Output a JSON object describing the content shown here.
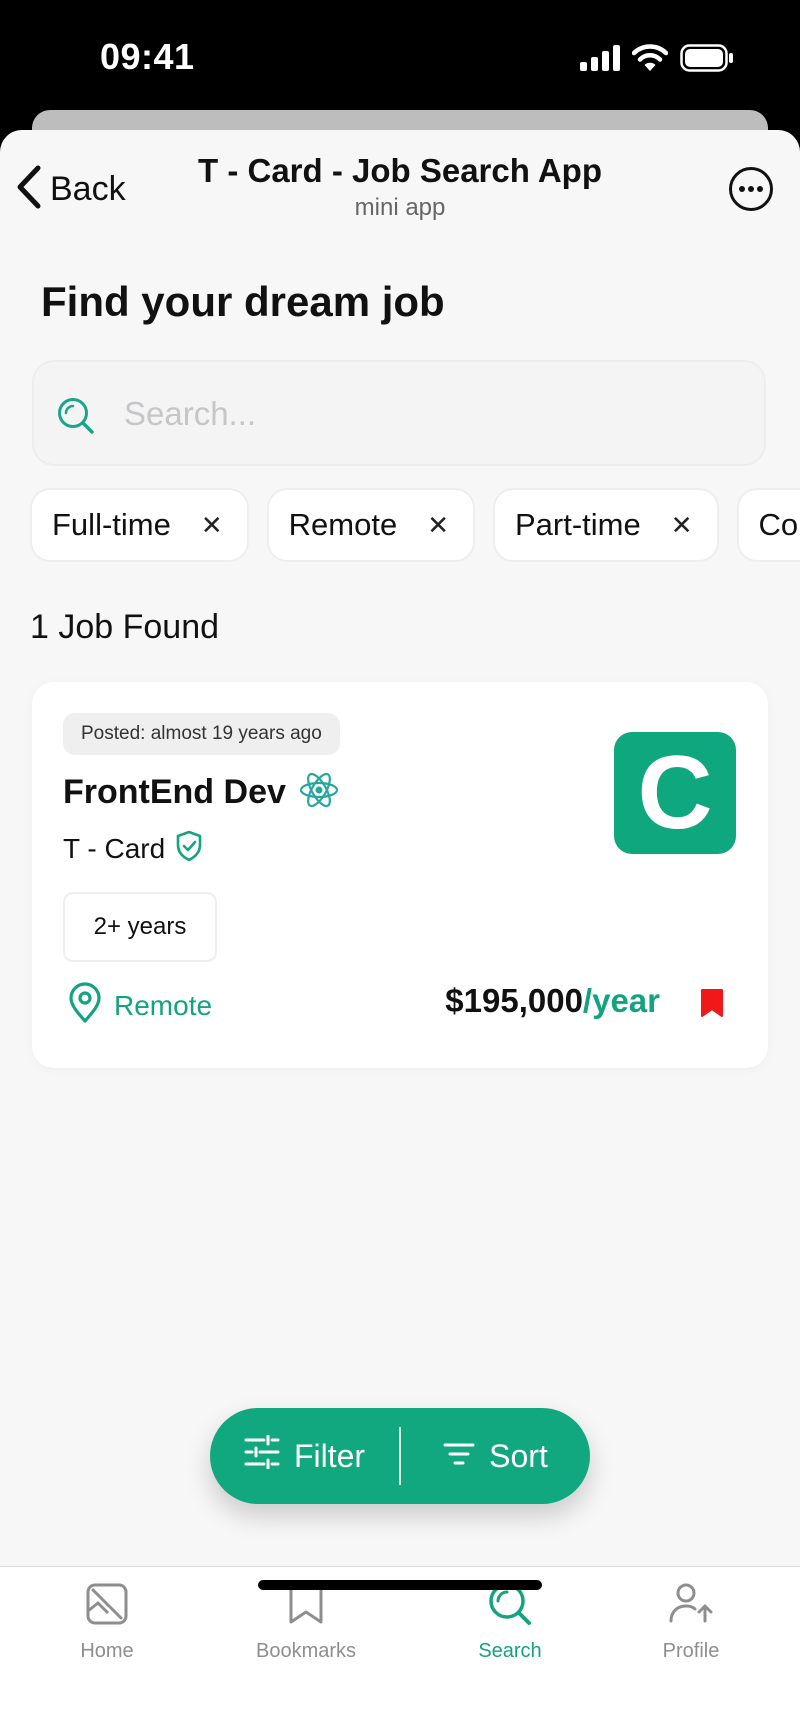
{
  "status_bar": {
    "time": "09:41",
    "icons": [
      "signal-icon",
      "wifi-icon",
      "battery-icon"
    ]
  },
  "header": {
    "back_label": "Back",
    "title": "T - Card - Job Search App",
    "subtitle": "mini app",
    "more_icon": "more-icon"
  },
  "page": {
    "title": "Find your dream job"
  },
  "search": {
    "placeholder": "Search...",
    "value": ""
  },
  "filters": [
    {
      "label": "Full-time"
    },
    {
      "label": "Remote"
    },
    {
      "label": "Part-time"
    },
    {
      "label": "Co"
    }
  ],
  "results": {
    "count_label": "1 Job Found"
  },
  "job": {
    "posted": "Posted: almost 19 years ago",
    "title": "FrontEnd Dev",
    "title_icon": "react-icon",
    "company": "T - Card",
    "verified_icon": "verified-shield-icon",
    "logo_letter": "C",
    "experience": "2+ years",
    "location": "Remote",
    "salary": "$195,000",
    "salary_period": "/year",
    "bookmarked": true
  },
  "actions": {
    "filter_label": "Filter",
    "sort_label": "Sort"
  },
  "nav": {
    "items": [
      {
        "label": "Home",
        "icon": "home-icon",
        "active": false
      },
      {
        "label": "Bookmarks",
        "icon": "bookmark-icon",
        "active": false
      },
      {
        "label": "Search",
        "icon": "search-icon",
        "active": true
      },
      {
        "label": "Profile",
        "icon": "profile-icon",
        "active": false
      }
    ]
  },
  "colors": {
    "accent": "#11a880",
    "bookmark": "#f01818",
    "background": "#f7f7f8"
  }
}
